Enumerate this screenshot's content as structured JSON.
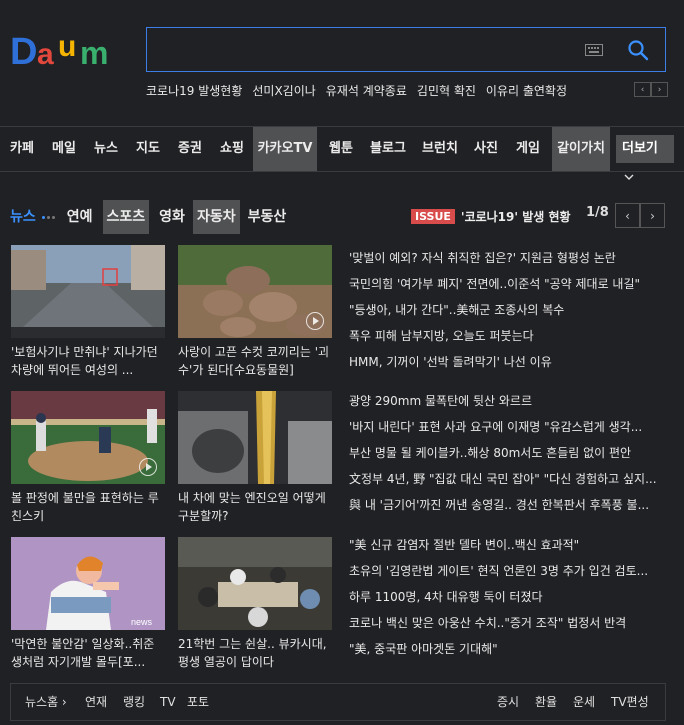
{
  "logo": {
    "text": "Daum"
  },
  "search": {
    "value": "",
    "placeholder": ""
  },
  "trends": [
    "코로나19 발생현황",
    "선미X김이나",
    "유재석 계약종료",
    "김민혁 확진",
    "이유리 출연확정"
  ],
  "trend_nav": {
    "prev": "‹",
    "next": "›"
  },
  "gnb": {
    "items": [
      "카페",
      "메일",
      "뉴스",
      "지도",
      "증권",
      "쇼핑",
      "카카오TV",
      "웹툰",
      "블로그",
      "브런치",
      "사진",
      "게임",
      "같이가치"
    ],
    "more": "더보기",
    "highlighted": [
      "카카오TV",
      "같이가치"
    ]
  },
  "tabs": [
    {
      "label": "뉴스",
      "state": "active"
    },
    {
      "label": "연예",
      "state": "normal"
    },
    {
      "label": "스포츠",
      "state": "highlighted"
    },
    {
      "label": "영화",
      "state": "normal"
    },
    {
      "label": "자동차",
      "state": "highlighted"
    },
    {
      "label": "부동산",
      "state": "normal"
    }
  ],
  "issue": {
    "badge": "ISSUE",
    "text": "'코로나19' 발생 현황"
  },
  "pager": {
    "current": "1/8",
    "prev": "‹",
    "next": "›"
  },
  "cards": [
    {
      "title": "'보험사기냐 만취냐' 지나가던 차량에 뛰어든 여성의 ...",
      "overlay": "",
      "video": false
    },
    {
      "title": "사랑이 고픈 수컷 코끼리는 '괴수'가 된다[수요동물원]",
      "overlay": "",
      "video": true
    },
    {
      "title": "볼 판정에 불만을 표현하는 루친스키",
      "overlay": "",
      "video": true
    },
    {
      "title": "내 차에 맞는 엔진오일 어떻게 구분할까?",
      "overlay": "",
      "video": false
    },
    {
      "title": "'막연한 불안감' 일상화..취준생처럼 자기개발 몰두[포...",
      "overlay": "news",
      "video": false
    },
    {
      "title": "21학번 그는 쉰살.. 뷰카시대, 평생 열공이 답이다",
      "overlay": "",
      "video": false
    }
  ],
  "headlines": [
    "'맞벌이 예외? 자식 취직한 집은?' 지원금 형평성 논란",
    "국민의힘 '여가부 폐지' 전면에..이준석 \"공약 제대로 내길\"",
    "\"등생아, 내가 간다\"..美해군 조종사의 복수",
    "폭우 피해 남부지방, 오늘도 퍼붓는다",
    "HMM, 기꺼이 '선박 돌려막기' 나선 이유",
    "광양 290mm 물폭탄에 뒷산 와르르",
    "'바지 내린다' 표현 사과 요구에 이재명 \"유감스럽게 생각...",
    "부산 명물 될 케이블카..해상 80m서도 흔들림 없이 편안",
    "文정부 4년, 野 \"집값 대신 국민 잡아\" \"다신 경험하고 싶지...",
    "與 내 '금기어'까진 꺼낸 송영길.. 경선 한복판서 후폭풍 불...",
    "\"美 신규 감염자 절반 델타 변이..백신 효과적\"",
    "초유의 '김영란법 게이트' 현직 언론인 3명 추가 입건 검토...",
    "하루 1100명, 4차 대유행 둑이 터졌다",
    "코로나 백신 맞은 아웅산 수치..\"증거 조작\" 법정서 반격",
    "\"美, 중국판 아마겟돈 기대해\""
  ],
  "bottom_bar": {
    "left": [
      "뉴스홈 ›",
      "연재",
      "랭킹",
      "TV",
      "포토"
    ],
    "right": [
      "증시",
      "환율",
      "운세",
      "TV편성"
    ]
  },
  "colors": {
    "background": "#202124",
    "accent": "#3b91ff",
    "highlight": "#505153",
    "issue_badge": "#d84c4c"
  }
}
